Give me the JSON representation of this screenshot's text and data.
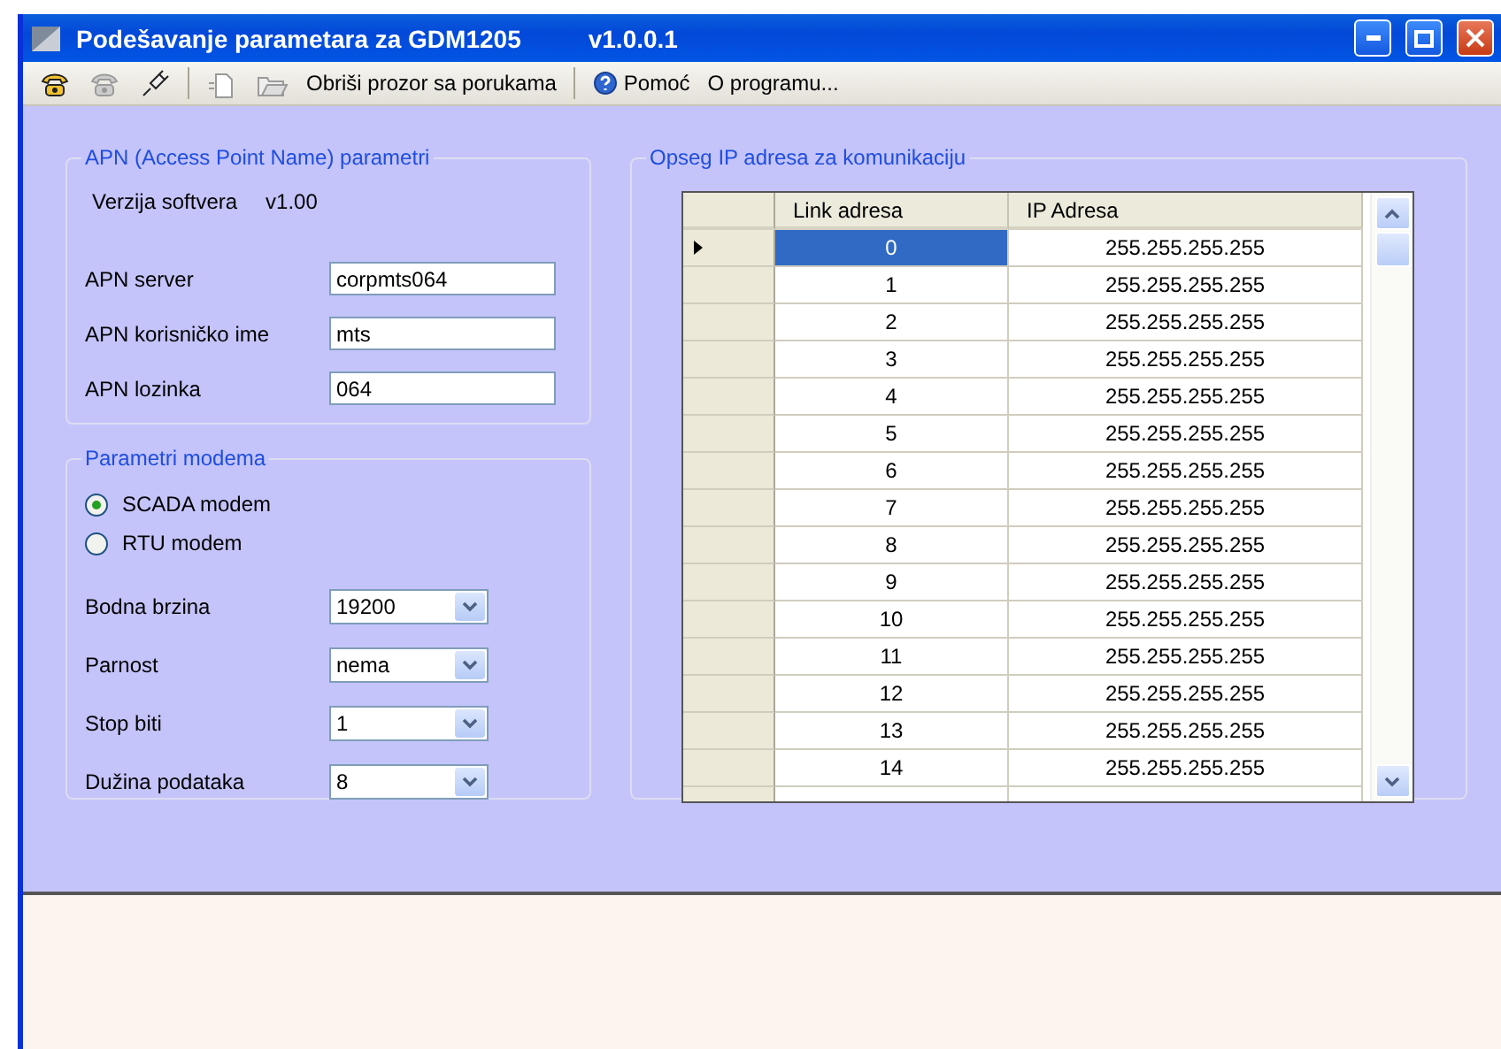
{
  "window": {
    "title": "Podešavanje parametara za GDM1205",
    "version": "v1.0.0.1"
  },
  "toolbar": [
    {
      "kind": "phone",
      "disabled": false
    },
    {
      "kind": "phone",
      "disabled": true
    },
    {
      "kind": "plug",
      "disabled": false
    },
    {
      "kind": "separator"
    },
    {
      "kind": "document",
      "disabled": true
    },
    {
      "kind": "folder",
      "disabled": true
    },
    {
      "kind": "text",
      "label": "Obriši prozor sa porukama"
    },
    {
      "kind": "separator"
    },
    {
      "kind": "help",
      "label": "Pomoć"
    },
    {
      "kind": "text",
      "label": "O programu..."
    }
  ],
  "apn": {
    "title": "APN (Access Point Name) parametri",
    "version_label": "Verzija softvera",
    "version_value": "v1.00",
    "fields": [
      {
        "label": "APN server",
        "value": "corpmts064"
      },
      {
        "label": "APN korisničko ime",
        "value": "mts"
      },
      {
        "label": "APN lozinka",
        "value": "064"
      }
    ]
  },
  "modem": {
    "title": "Parametri modema",
    "radios": [
      {
        "label": "SCADA modem",
        "selected": true
      },
      {
        "label": "RTU modem",
        "selected": false
      }
    ],
    "selects": [
      {
        "label": "Bodna brzina",
        "value": "19200"
      },
      {
        "label": "Parnost",
        "value": "nema"
      },
      {
        "label": "Stop biti",
        "value": "1"
      },
      {
        "label": "Dužina podataka",
        "value": "8"
      }
    ]
  },
  "ip_range": {
    "title": "Opseg IP adresa za komunikaciju",
    "columns": [
      "Link adresa",
      "IP Adresa"
    ],
    "rows": [
      {
        "link": "0",
        "ip": "255.255.255.255",
        "selected": true
      },
      {
        "link": "1",
        "ip": "255.255.255.255",
        "selected": false
      },
      {
        "link": "2",
        "ip": "255.255.255.255",
        "selected": false
      },
      {
        "link": "3",
        "ip": "255.255.255.255",
        "selected": false
      },
      {
        "link": "4",
        "ip": "255.255.255.255",
        "selected": false
      },
      {
        "link": "5",
        "ip": "255.255.255.255",
        "selected": false
      },
      {
        "link": "6",
        "ip": "255.255.255.255",
        "selected": false
      },
      {
        "link": "7",
        "ip": "255.255.255.255",
        "selected": false
      },
      {
        "link": "8",
        "ip": "255.255.255.255",
        "selected": false
      },
      {
        "link": "9",
        "ip": "255.255.255.255",
        "selected": false
      },
      {
        "link": "10",
        "ip": "255.255.255.255",
        "selected": false
      },
      {
        "link": "11",
        "ip": "255.255.255.255",
        "selected": false
      },
      {
        "link": "12",
        "ip": "255.255.255.255",
        "selected": false
      },
      {
        "link": "13",
        "ip": "255.255.255.255",
        "selected": false
      },
      {
        "link": "14",
        "ip": "255.255.255.255",
        "selected": false
      }
    ]
  }
}
